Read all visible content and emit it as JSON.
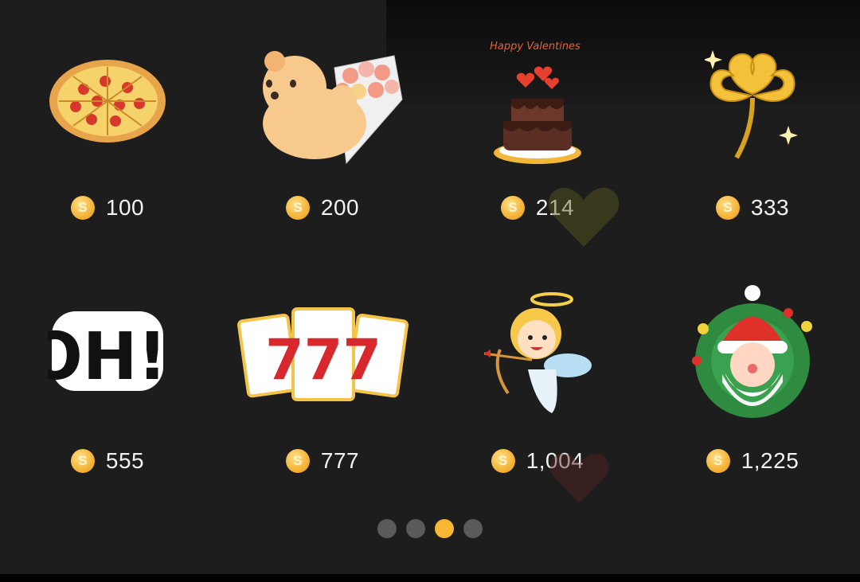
{
  "gifts": [
    {
      "name": "pizza",
      "price": "100"
    },
    {
      "name": "bear-bouquet",
      "price": "200"
    },
    {
      "name": "valentine-cake",
      "price": "214",
      "art_text": "Happy Valentines"
    },
    {
      "name": "golden-clover",
      "price": "333"
    },
    {
      "name": "oh-sticker",
      "price": "555",
      "art_text": "OH!"
    },
    {
      "name": "slot-777",
      "price": "777",
      "art_text": "777"
    },
    {
      "name": "cupid",
      "price": "1,004"
    },
    {
      "name": "santa-wreath",
      "price": "1,225"
    }
  ],
  "pagination": {
    "total": 4,
    "current_index": 2
  },
  "colors": {
    "accent": "#f7b634",
    "background": "#1d1d1d",
    "coin": "#f6b73c"
  },
  "icons": {
    "coin": "coin-icon",
    "heart": "heart-icon"
  }
}
